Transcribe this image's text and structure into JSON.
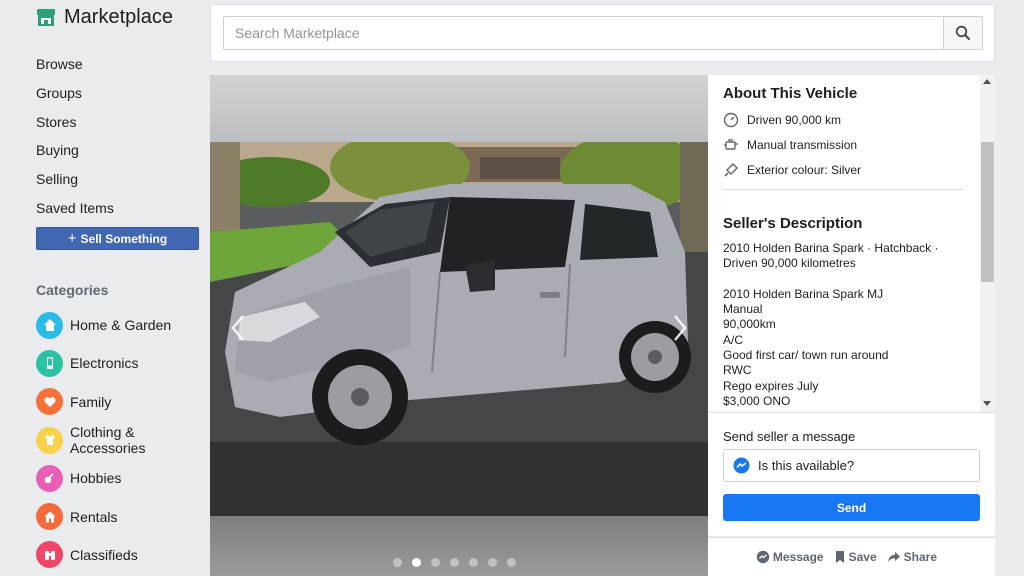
{
  "app": {
    "title": "Marketplace"
  },
  "search": {
    "placeholder": "Search Marketplace"
  },
  "nav": [
    {
      "label": "Browse"
    },
    {
      "label": "Groups"
    },
    {
      "label": "Stores"
    },
    {
      "label": "Buying"
    },
    {
      "label": "Selling"
    },
    {
      "label": "Saved Items"
    }
  ],
  "sell_button": {
    "label": "Sell Something"
  },
  "categories": {
    "heading": "Categories",
    "items": [
      {
        "label": "Home & Garden",
        "icon": "home-icon",
        "color": "#2abbe8"
      },
      {
        "label": "Electronics",
        "icon": "phone-icon",
        "color": "#2bc2a4"
      },
      {
        "label": "Family",
        "icon": "heart-icon",
        "color": "#f7713a"
      },
      {
        "label": "Clothing & Accessories",
        "icon": "shirt-icon",
        "color": "#f7d14a"
      },
      {
        "label": "Hobbies",
        "icon": "guitar-icon",
        "color": "#e85fb5"
      },
      {
        "label": "Rentals",
        "icon": "house-icon",
        "color": "#f56a3c"
      },
      {
        "label": "Classifieds",
        "icon": "binoculars-icon",
        "color": "#f0466a"
      }
    ]
  },
  "listing": {
    "about_title": "About This Vehicle",
    "features": [
      {
        "icon": "speedometer-icon",
        "text": "Driven 90,000 km"
      },
      {
        "icon": "engine-icon",
        "text": "Manual transmission"
      },
      {
        "icon": "paint-brush-icon",
        "text": "Exterior colour: Silver"
      }
    ],
    "desc_title": "Seller's Description",
    "description": {
      "summary_line1": "2010 Holden Barina Spark · Hatchback ·",
      "summary_line2": "Driven 90,000 kilometres",
      "lines": [
        "2010 Holden Barina Spark MJ",
        "Manual",
        "90,000km",
        "A/C",
        "Good first car/ town run around",
        "RWC",
        "Rego expires July",
        "$3,000 ONO"
      ]
    },
    "photo": {
      "dot_count": 7,
      "active_dot": 1
    }
  },
  "message": {
    "label": "Send seller a message",
    "text": "Is this available?",
    "send_label": "Send"
  },
  "actions": {
    "message": "Message",
    "save": "Save",
    "share": "Share"
  },
  "colors": {
    "brand_blue": "#4267b2",
    "send_blue": "#1877f2",
    "page_bg": "#e9ebee"
  }
}
